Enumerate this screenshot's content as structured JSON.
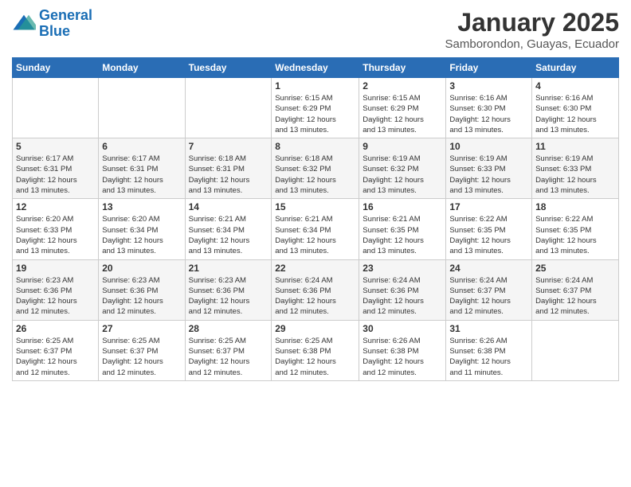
{
  "logo": {
    "line1": "General",
    "line2": "Blue"
  },
  "title": "January 2025",
  "subtitle": "Samborondon, Guayas, Ecuador",
  "days_of_week": [
    "Sunday",
    "Monday",
    "Tuesday",
    "Wednesday",
    "Thursday",
    "Friday",
    "Saturday"
  ],
  "weeks": [
    [
      {
        "day": "",
        "info": ""
      },
      {
        "day": "",
        "info": ""
      },
      {
        "day": "",
        "info": ""
      },
      {
        "day": "1",
        "info": "Sunrise: 6:15 AM\nSunset: 6:29 PM\nDaylight: 12 hours\nand 13 minutes."
      },
      {
        "day": "2",
        "info": "Sunrise: 6:15 AM\nSunset: 6:29 PM\nDaylight: 12 hours\nand 13 minutes."
      },
      {
        "day": "3",
        "info": "Sunrise: 6:16 AM\nSunset: 6:30 PM\nDaylight: 12 hours\nand 13 minutes."
      },
      {
        "day": "4",
        "info": "Sunrise: 6:16 AM\nSunset: 6:30 PM\nDaylight: 12 hours\nand 13 minutes."
      }
    ],
    [
      {
        "day": "5",
        "info": "Sunrise: 6:17 AM\nSunset: 6:31 PM\nDaylight: 12 hours\nand 13 minutes."
      },
      {
        "day": "6",
        "info": "Sunrise: 6:17 AM\nSunset: 6:31 PM\nDaylight: 12 hours\nand 13 minutes."
      },
      {
        "day": "7",
        "info": "Sunrise: 6:18 AM\nSunset: 6:31 PM\nDaylight: 12 hours\nand 13 minutes."
      },
      {
        "day": "8",
        "info": "Sunrise: 6:18 AM\nSunset: 6:32 PM\nDaylight: 12 hours\nand 13 minutes."
      },
      {
        "day": "9",
        "info": "Sunrise: 6:19 AM\nSunset: 6:32 PM\nDaylight: 12 hours\nand 13 minutes."
      },
      {
        "day": "10",
        "info": "Sunrise: 6:19 AM\nSunset: 6:33 PM\nDaylight: 12 hours\nand 13 minutes."
      },
      {
        "day": "11",
        "info": "Sunrise: 6:19 AM\nSunset: 6:33 PM\nDaylight: 12 hours\nand 13 minutes."
      }
    ],
    [
      {
        "day": "12",
        "info": "Sunrise: 6:20 AM\nSunset: 6:33 PM\nDaylight: 12 hours\nand 13 minutes."
      },
      {
        "day": "13",
        "info": "Sunrise: 6:20 AM\nSunset: 6:34 PM\nDaylight: 12 hours\nand 13 minutes."
      },
      {
        "day": "14",
        "info": "Sunrise: 6:21 AM\nSunset: 6:34 PM\nDaylight: 12 hours\nand 13 minutes."
      },
      {
        "day": "15",
        "info": "Sunrise: 6:21 AM\nSunset: 6:34 PM\nDaylight: 12 hours\nand 13 minutes."
      },
      {
        "day": "16",
        "info": "Sunrise: 6:21 AM\nSunset: 6:35 PM\nDaylight: 12 hours\nand 13 minutes."
      },
      {
        "day": "17",
        "info": "Sunrise: 6:22 AM\nSunset: 6:35 PM\nDaylight: 12 hours\nand 13 minutes."
      },
      {
        "day": "18",
        "info": "Sunrise: 6:22 AM\nSunset: 6:35 PM\nDaylight: 12 hours\nand 13 minutes."
      }
    ],
    [
      {
        "day": "19",
        "info": "Sunrise: 6:23 AM\nSunset: 6:36 PM\nDaylight: 12 hours\nand 12 minutes."
      },
      {
        "day": "20",
        "info": "Sunrise: 6:23 AM\nSunset: 6:36 PM\nDaylight: 12 hours\nand 12 minutes."
      },
      {
        "day": "21",
        "info": "Sunrise: 6:23 AM\nSunset: 6:36 PM\nDaylight: 12 hours\nand 12 minutes."
      },
      {
        "day": "22",
        "info": "Sunrise: 6:24 AM\nSunset: 6:36 PM\nDaylight: 12 hours\nand 12 minutes."
      },
      {
        "day": "23",
        "info": "Sunrise: 6:24 AM\nSunset: 6:36 PM\nDaylight: 12 hours\nand 12 minutes."
      },
      {
        "day": "24",
        "info": "Sunrise: 6:24 AM\nSunset: 6:37 PM\nDaylight: 12 hours\nand 12 minutes."
      },
      {
        "day": "25",
        "info": "Sunrise: 6:24 AM\nSunset: 6:37 PM\nDaylight: 12 hours\nand 12 minutes."
      }
    ],
    [
      {
        "day": "26",
        "info": "Sunrise: 6:25 AM\nSunset: 6:37 PM\nDaylight: 12 hours\nand 12 minutes."
      },
      {
        "day": "27",
        "info": "Sunrise: 6:25 AM\nSunset: 6:37 PM\nDaylight: 12 hours\nand 12 minutes."
      },
      {
        "day": "28",
        "info": "Sunrise: 6:25 AM\nSunset: 6:37 PM\nDaylight: 12 hours\nand 12 minutes."
      },
      {
        "day": "29",
        "info": "Sunrise: 6:25 AM\nSunset: 6:38 PM\nDaylight: 12 hours\nand 12 minutes."
      },
      {
        "day": "30",
        "info": "Sunrise: 6:26 AM\nSunset: 6:38 PM\nDaylight: 12 hours\nand 12 minutes."
      },
      {
        "day": "31",
        "info": "Sunrise: 6:26 AM\nSunset: 6:38 PM\nDaylight: 12 hours\nand 11 minutes."
      },
      {
        "day": "",
        "info": ""
      }
    ]
  ]
}
